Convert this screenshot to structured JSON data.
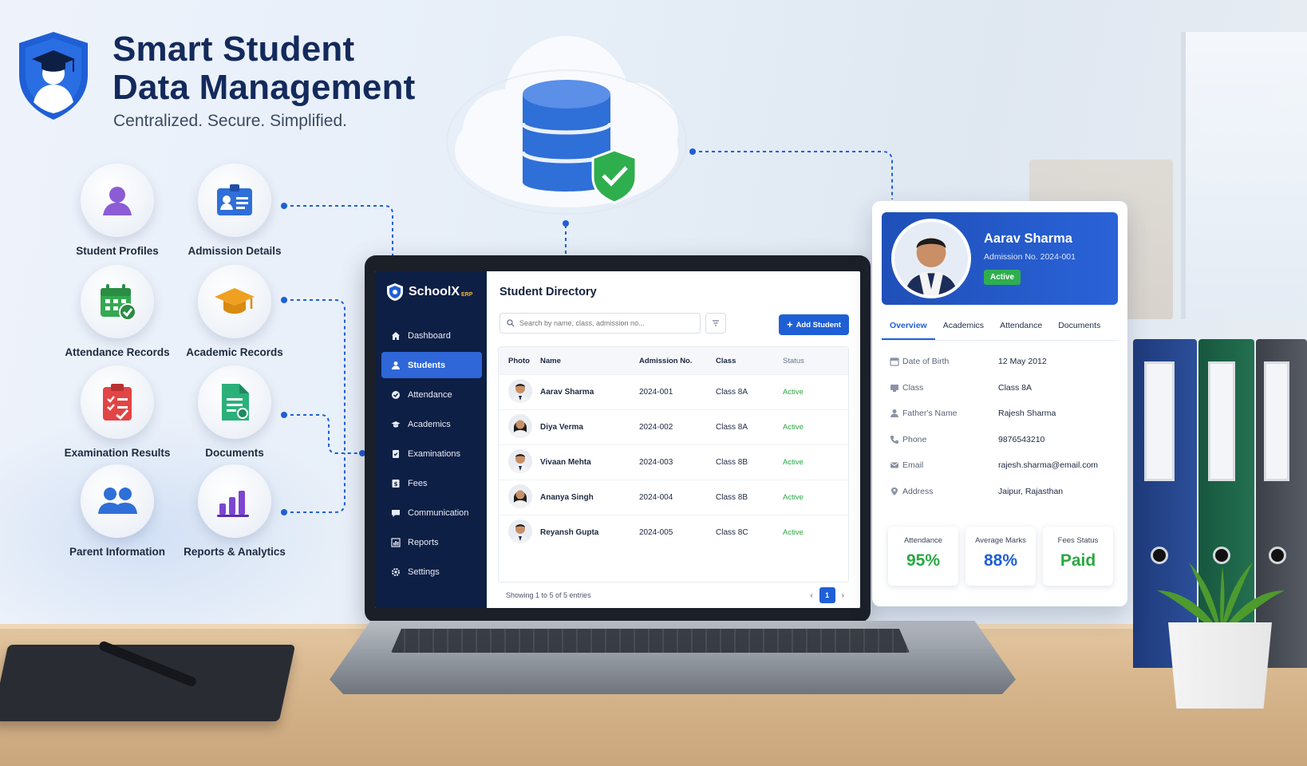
{
  "header": {
    "title_line1": "Smart Student",
    "title_line2": "Data Management",
    "subtitle": "Centralized. Secure. Simplified."
  },
  "features": [
    {
      "label": "Student Profiles",
      "icon": "student-profile-icon",
      "color": "#8b5cd6"
    },
    {
      "label": "Admission Details",
      "icon": "id-card-icon",
      "color": "#2f6fd8"
    },
    {
      "label": "Attendance Records",
      "icon": "calendar-check-icon",
      "color": "#35a852"
    },
    {
      "label": "Academic Records",
      "icon": "graduation-cap-icon",
      "color": "#f0a020"
    },
    {
      "label": "Examination Results",
      "icon": "clipboard-check-icon",
      "color": "#e14545"
    },
    {
      "label": "Documents",
      "icon": "document-icon",
      "color": "#2bb07a"
    },
    {
      "label": "Parent Information",
      "icon": "parents-icon",
      "color": "#2f6fd8"
    },
    {
      "label": "Reports & Analytics",
      "icon": "bar-chart-icon",
      "color": "#7b46d0"
    }
  ],
  "app": {
    "brand": "SchoolX",
    "brand_suffix": "ERP",
    "nav": [
      {
        "label": "Dashboard",
        "icon": "home-icon"
      },
      {
        "label": "Students",
        "icon": "user-icon",
        "active": true
      },
      {
        "label": "Attendance",
        "icon": "check-icon"
      },
      {
        "label": "Academics",
        "icon": "cap-icon"
      },
      {
        "label": "Examinations",
        "icon": "exam-icon"
      },
      {
        "label": "Fees",
        "icon": "fees-icon"
      },
      {
        "label": "Communication",
        "icon": "chat-icon"
      },
      {
        "label": "Reports",
        "icon": "reports-icon"
      },
      {
        "label": "Settings",
        "icon": "gear-icon"
      }
    ],
    "page_title": "Student Directory",
    "search_placeholder": "Search by name, class, admission no...",
    "add_button": "Add Student",
    "columns": [
      "Photo",
      "Name",
      "Admission No.",
      "Class",
      "Status"
    ],
    "rows": [
      {
        "name": "Aarav Sharma",
        "admission": "2024-001",
        "class": "Class 8A",
        "status": "Active"
      },
      {
        "name": "Diya Verma",
        "admission": "2024-002",
        "class": "Class 8A",
        "status": "Active"
      },
      {
        "name": "Vivaan Mehta",
        "admission": "2024-003",
        "class": "Class 8B",
        "status": "Active"
      },
      {
        "name": "Ananya Singh",
        "admission": "2024-004",
        "class": "Class 8B",
        "status": "Active"
      },
      {
        "name": "Reyansh Gupta",
        "admission": "2024-005",
        "class": "Class 8C",
        "status": "Active"
      }
    ],
    "footer_info": "Showing 1 to 5 of 5 entries",
    "current_page": "1"
  },
  "profile": {
    "name": "Aarav Sharma",
    "admission": "Admission No. 2024-001",
    "status": "Active",
    "tabs": [
      "Overview",
      "Academics",
      "Attendance",
      "Documents"
    ],
    "details": [
      {
        "label": "Date of Birth",
        "value": "12 May 2012",
        "icon": "calendar-icon"
      },
      {
        "label": "Class",
        "value": "Class 8A",
        "icon": "class-icon"
      },
      {
        "label": "Father's Name",
        "value": "Rajesh Sharma",
        "icon": "person-icon"
      },
      {
        "label": "Phone",
        "value": "9876543210",
        "icon": "phone-icon"
      },
      {
        "label": "Email",
        "value": "rajesh.sharma@email.com",
        "icon": "mail-icon"
      },
      {
        "label": "Address",
        "value": "Jaipur, Rajasthan",
        "icon": "location-icon"
      }
    ],
    "stats": [
      {
        "label": "Attendance",
        "value": "95%",
        "color": "#2aa844"
      },
      {
        "label": "Average Marks",
        "value": "88%",
        "color": "#1f5fd6"
      },
      {
        "label": "Fees Status",
        "value": "Paid",
        "color": "#2aa844"
      }
    ]
  },
  "colors": {
    "navy": "#0e1f45",
    "accent": "#1f5fd6",
    "title": "#132a5c",
    "success": "#2aa844"
  }
}
